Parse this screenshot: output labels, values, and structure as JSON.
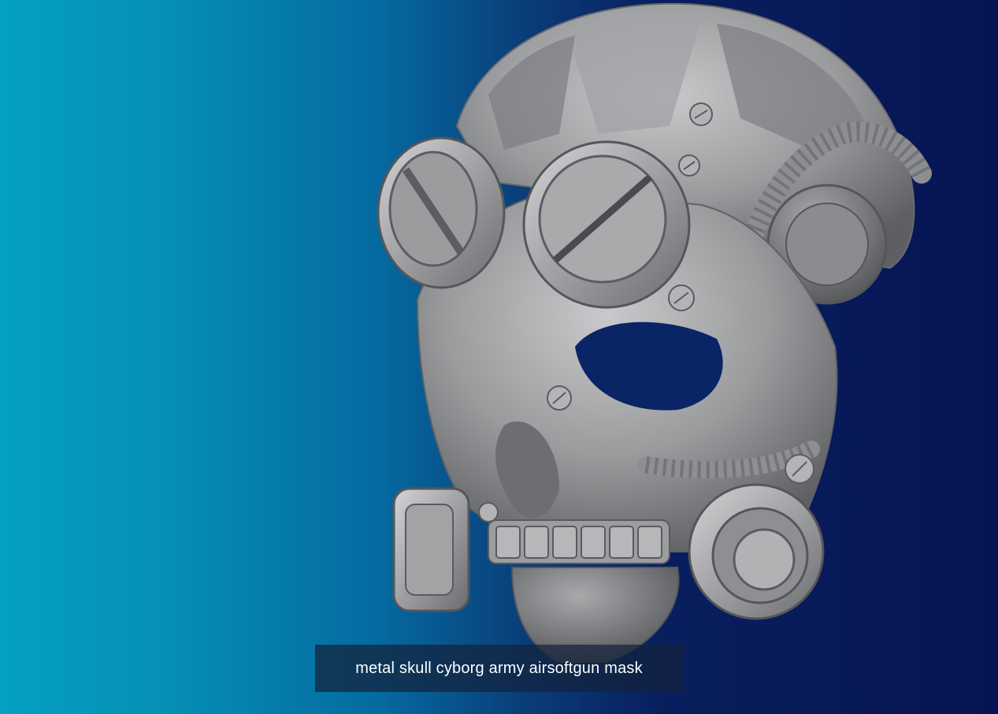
{
  "background": {
    "colors": [
      "#05a0c2",
      "#0a3f7a",
      "#071454"
    ]
  },
  "model": {
    "icon": "skull-mask-render",
    "surface_color": "#8f9092"
  },
  "caption": {
    "text": "metal skull cyborg army airsoftgun mask"
  }
}
